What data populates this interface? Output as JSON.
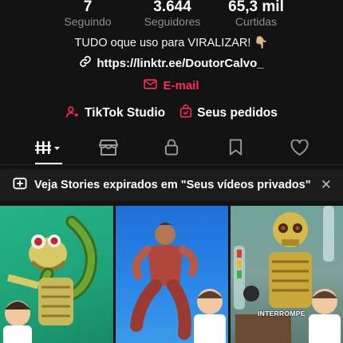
{
  "stats": [
    {
      "value": "7",
      "label": "Seguindo"
    },
    {
      "value": "3.644",
      "label": "Seguidores"
    },
    {
      "value": "65,3 mil",
      "label": "Curtidas"
    }
  ],
  "bio": {
    "text": "TUDO oque uso para VIRALIZAR! 👇🏼",
    "link": "https://linktr.ee/DoutorCalvo_",
    "email_label": "E-mail"
  },
  "actions": {
    "studio": "TikTok Studio",
    "orders": "Seus pedidos"
  },
  "tabs": [
    "videos-grid",
    "shop",
    "private",
    "saved",
    "liked"
  ],
  "banner": {
    "text": "Veja Stories expirados em \"Seus vídeos privados\"",
    "close": "✕"
  },
  "thumbnails": [
    {
      "overlay_text": ""
    },
    {
      "overlay_text": ""
    },
    {
      "overlay_text": "INTERROMPE"
    }
  ],
  "colors": {
    "accent": "#fe2c55",
    "background": "#121212"
  }
}
